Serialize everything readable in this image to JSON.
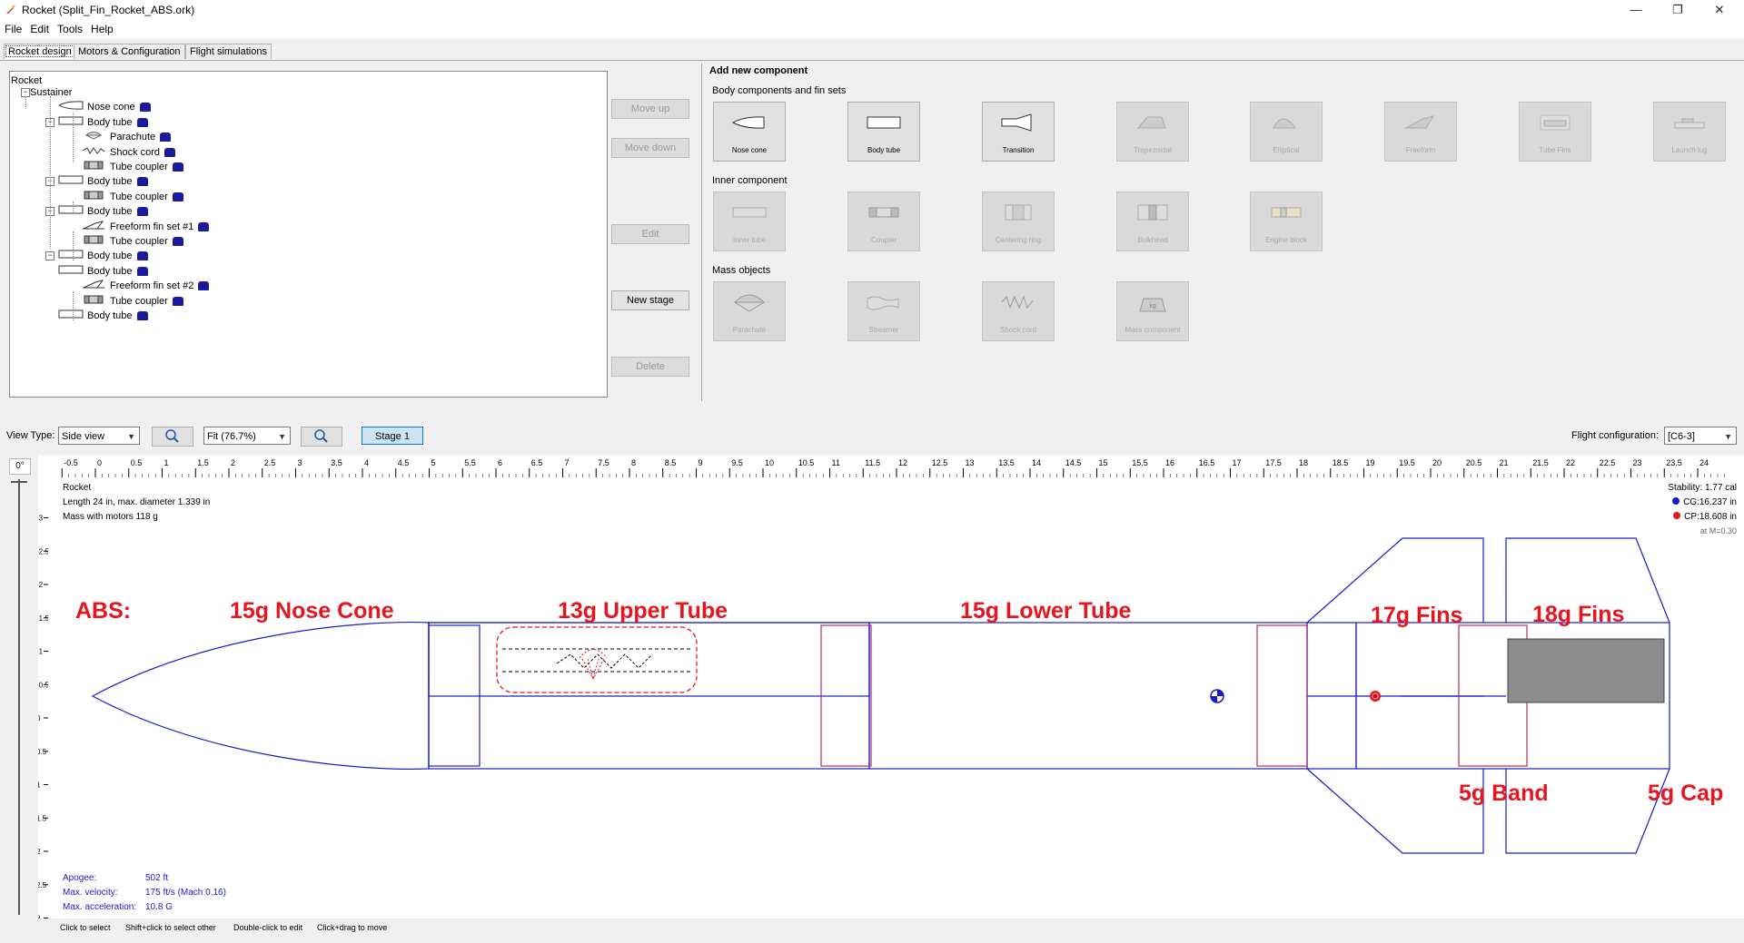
{
  "window": {
    "title": "Rocket (Split_Fin_Rocket_ABS.ork)",
    "controls": [
      "—",
      "❐",
      "✕"
    ]
  },
  "menu": [
    "File",
    "Edit",
    "Tools",
    "Help"
  ],
  "tabs": [
    "Rocket design",
    "Motors & Configuration",
    "Flight simulations"
  ],
  "tree": {
    "root": "Rocket",
    "items": [
      {
        "label": "Sustainer",
        "level": 0,
        "icon": "none"
      },
      {
        "label": "Nose cone",
        "level": 1,
        "icon": "nosecone"
      },
      {
        "label": "Body tube",
        "level": 1,
        "icon": "bodytube"
      },
      {
        "label": "Parachute",
        "level": 2,
        "icon": "parachute"
      },
      {
        "label": "Shock cord",
        "level": 2,
        "icon": "shockcord"
      },
      {
        "label": "Tube coupler",
        "level": 2,
        "icon": "coupler"
      },
      {
        "label": "Body tube",
        "level": 1,
        "icon": "bodytube"
      },
      {
        "label": "Tube coupler",
        "level": 2,
        "icon": "coupler"
      },
      {
        "label": "Body tube",
        "level": 1,
        "icon": "bodytube"
      },
      {
        "label": "Freeform fin set #1",
        "level": 2,
        "icon": "freeform"
      },
      {
        "label": "Tube coupler",
        "level": 2,
        "icon": "coupler"
      },
      {
        "label": "Body tube",
        "level": 1,
        "icon": "bodytube"
      },
      {
        "label": "Body tube",
        "level": 1,
        "icon": "bodytube"
      },
      {
        "label": "Freeform fin set #2",
        "level": 2,
        "icon": "freeform"
      },
      {
        "label": "Tube coupler",
        "level": 2,
        "icon": "coupler"
      },
      {
        "label": "Body tube",
        "level": 1,
        "icon": "bodytube"
      }
    ]
  },
  "side_buttons": {
    "move_up": "Move up",
    "move_down": "Move down",
    "edit": "Edit",
    "new_stage": "New stage",
    "delete": "Delete"
  },
  "add_component": {
    "title": "Add new component",
    "sections": [
      {
        "label": "Body components and fin sets",
        "items": [
          {
            "label": "Nose cone",
            "icon": "nosecone-icon",
            "enabled": true
          },
          {
            "label": "Body tube",
            "icon": "bodytube-icon",
            "enabled": true
          },
          {
            "label": "Transition",
            "icon": "transition-icon",
            "enabled": true
          },
          {
            "label": "Trapezoidal",
            "icon": "trapezoidal-icon",
            "enabled": false
          },
          {
            "label": "Elliptical",
            "icon": "elliptical-icon",
            "enabled": false
          },
          {
            "label": "Freeform",
            "icon": "freeform-icon",
            "enabled": false
          },
          {
            "label": "Tube Fins",
            "icon": "tubefins-icon",
            "enabled": false
          },
          {
            "label": "Launch lug",
            "icon": "launchlug-icon",
            "enabled": false
          }
        ]
      },
      {
        "label": "Inner component",
        "items": [
          {
            "label": "Inner tube",
            "icon": "innertube-icon",
            "enabled": false
          },
          {
            "label": "Coupler",
            "icon": "coupler-icon",
            "enabled": false
          },
          {
            "label": "Centering ring",
            "icon": "centeringring-icon",
            "enabled": false
          },
          {
            "label": "Bulkhead",
            "icon": "bulkhead-icon",
            "enabled": false
          },
          {
            "label": "Engine block",
            "icon": "engineblock-icon",
            "enabled": false
          }
        ]
      },
      {
        "label": "Mass objects",
        "items": [
          {
            "label": "Parachute",
            "icon": "parachute-icon",
            "enabled": false
          },
          {
            "label": "Streamer",
            "icon": "streamer-icon",
            "enabled": false
          },
          {
            "label": "Shock cord",
            "icon": "shockcord-icon",
            "enabled": false
          },
          {
            "label": "Mass component",
            "icon": "mass-icon",
            "enabled": false
          }
        ]
      }
    ]
  },
  "view": {
    "type_label": "View Type:",
    "type_value": "Side view",
    "zoom_value": "Fit (76.7%)",
    "stage_button": "Stage 1",
    "flight_config_label": "Flight configuration:",
    "flight_config_value": "[C6-3]"
  },
  "canvas": {
    "rotation": "0°",
    "ruler_top": [
      "-0.5",
      "0",
      "0.5",
      "1",
      "1.5",
      "2",
      "2.5",
      "3",
      "3.5",
      "4",
      "4.5",
      "5",
      "5.5",
      "6",
      "6.5",
      "7",
      "7.5",
      "8",
      "8.5",
      "9",
      "9.5",
      "10",
      "10.5",
      "11",
      "11.5",
      "12",
      "12.5",
      "13",
      "13.5",
      "14",
      "14.5",
      "15",
      "15.5",
      "16",
      "16.5",
      "17",
      "17.5",
      "18",
      "18.5",
      "19",
      "19.5",
      "20",
      "20.5",
      "21",
      "21.5",
      "22",
      "22.5",
      "23",
      "23.5",
      "24"
    ],
    "ruler_left": [
      "-3",
      "-2.5",
      "-2",
      "-1.5",
      "-1",
      "-0.5",
      "0",
      "0.5",
      "1",
      "1.5",
      "2",
      "2.5",
      "3"
    ],
    "info": {
      "name": "Rocket",
      "length": "Length 24 in, max. diameter 1.339 in",
      "mass": "Mass with motors 118 g"
    },
    "stability": {
      "stability": "Stability:  1.77 cal",
      "cg": "CG:16.237 in",
      "cp": "CP:18.608 in",
      "mach": "at M=0.30"
    },
    "flight": {
      "apogee_label": "Apogee:",
      "apogee_value": "502 ft",
      "velocity_label": "Max. velocity:",
      "velocity_value": "175 ft/s  (Mach 0.16)",
      "accel_label": "Max. acceleration:",
      "accel_value": "10.8 G"
    },
    "annotations": {
      "abs": "ABS:",
      "nose": "15g Nose Cone",
      "upper": "13g Upper Tube",
      "lower": "15g Lower Tube",
      "fins17": "17g Fins",
      "fins18": "18g Fins",
      "band": "5g Band",
      "cap": "5g Cap"
    },
    "colors": {
      "outline": "#1a1acc",
      "inner": "#b0306a",
      "annotation": "#e8141e",
      "motor": "#8c8c8c"
    }
  },
  "status": {
    "click": "Click to select",
    "shift": "Shift+click to select other",
    "double": "Double-click to edit",
    "drag": "Click+drag to move"
  }
}
